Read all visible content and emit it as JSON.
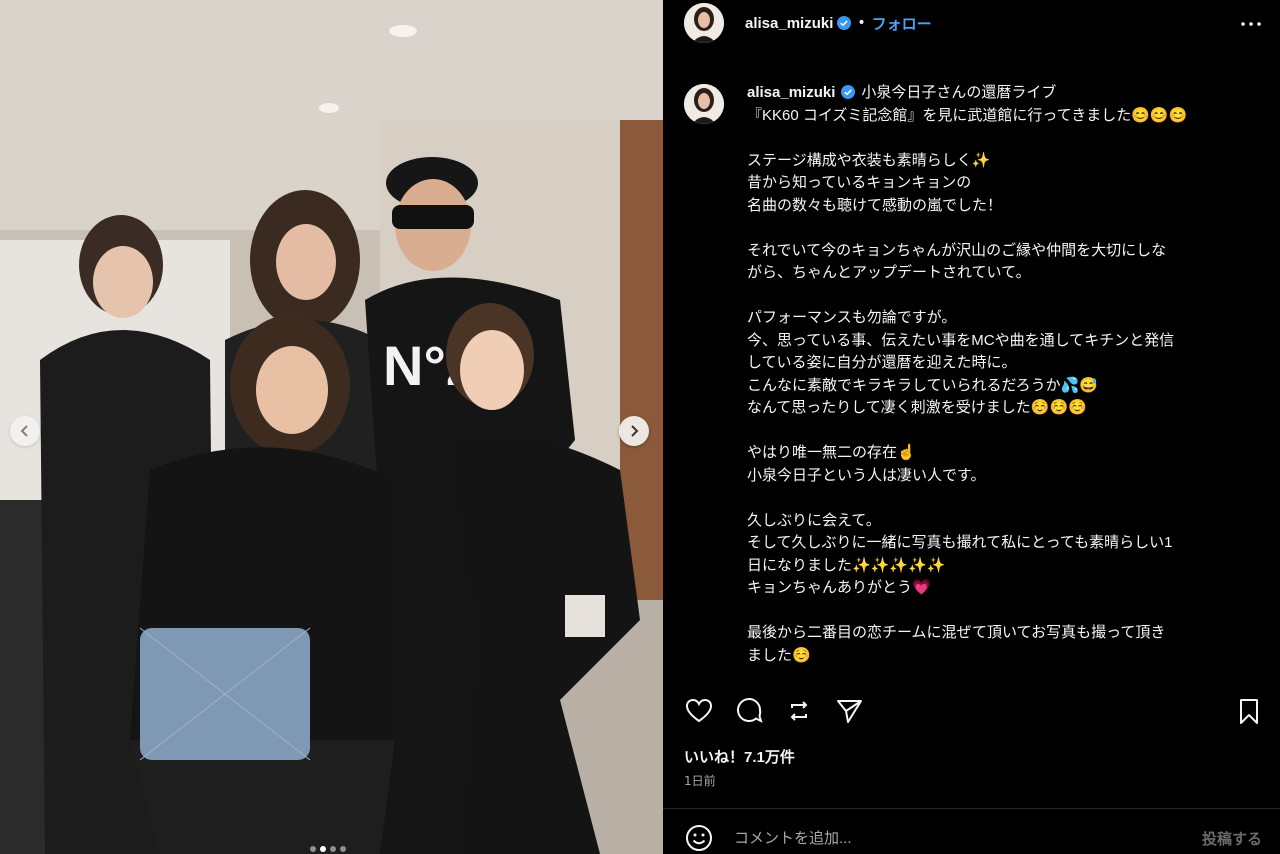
{
  "post": {
    "username": "alisa_mizuki",
    "follow_label": "フォロー",
    "separator": "•",
    "caption_text": "小泉今日子さんの還暦ライブ\n『KK60 コイズミ記念館』を見に武道館に行ってきました😊😊😊\n\nステージ構成や衣装も素晴らしく✨\n昔から知っているキョンキョンの\n名曲の数々も聴けて感動の嵐でした！\n\nそれでいて今のキョンちゃんが沢山のご縁や仲間を大切にしな\nがら、ちゃんとアップデートされていて。\n\nパフォーマンスも勿論ですが。\n今、思っている事、伝えたい事をMCや曲を通してキチンと発信\nしている姿に自分が還暦を迎えた時に。\nこんなに素敵でキラキラしていられるだろうか💦😅\nなんて思ったりして凄く刺激を受けました☺️☺️☺️\n\nやはり唯一無二の存在☝️\n小泉今日子という人は凄い人です。\n\n久しぶりに会えて。\nそして久しぶりに一緒に写真も撮れて私にとっても素晴らしい1\n日になりました✨✨✨✨✨\nキョンちゃんありがとう💗\n\n最後から二番目の恋チームに混ぜて頂いてお写真も撮って頂き\nました☺️",
    "likes_label": "いいね！7.1万件",
    "date_label": "1日前",
    "comment_placeholder": "コメントを追加...",
    "post_button_label": "投稿する"
  },
  "icons": {
    "verified": "verified-badge-icon",
    "more": "more-options-icon",
    "like": "heart-icon",
    "comment": "comment-bubble-icon",
    "share": "repost-icon",
    "send": "send-icon",
    "save": "bookmark-icon",
    "emoji": "emoji-icon",
    "prev": "chevron-left-icon",
    "next": "chevron-right-icon"
  },
  "carousel": {
    "slide_count": 4,
    "active_index": 1
  },
  "colors": {
    "background": "#000000",
    "link_blue": "#4aa4f6",
    "verified_blue": "#3897f0",
    "muted_text": "#a8a8a8"
  }
}
